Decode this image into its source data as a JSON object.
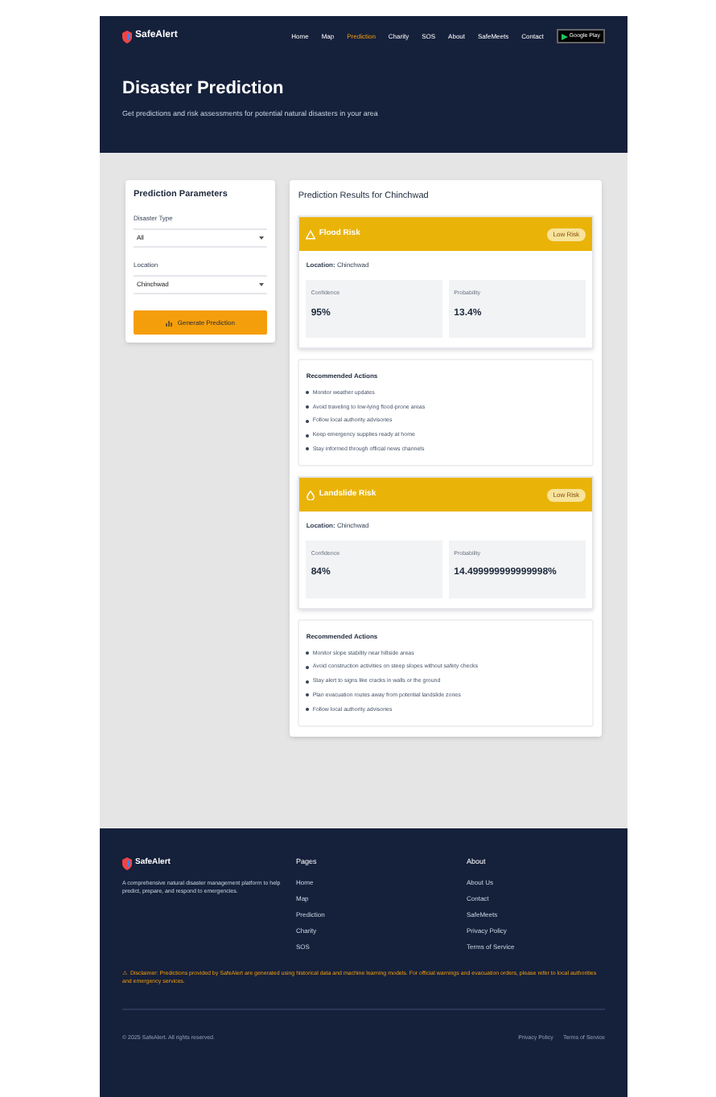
{
  "nav": {
    "brand": "SafeAlert",
    "links": [
      {
        "label": "Home",
        "selected": false
      },
      {
        "label": "Map",
        "selected": false
      },
      {
        "label": "Prediction",
        "selected": true
      },
      {
        "label": "Charity",
        "selected": false
      },
      {
        "label": "SOS",
        "selected": false
      },
      {
        "label": "About",
        "selected": false
      },
      {
        "label": "SafeMeets",
        "selected": false
      },
      {
        "label": "Contact",
        "selected": false
      }
    ],
    "store_badge": "Google Play"
  },
  "hero": {
    "title": "Disaster Prediction",
    "subtitle": "Get predictions and risk assessments for potential natural disasters in your area"
  },
  "parameters": {
    "title": "Prediction Parameters",
    "fields": [
      {
        "label": "Disaster Type",
        "value": "All"
      },
      {
        "label": "Location",
        "value": "Chinchwad"
      }
    ],
    "button": "Generate Prediction"
  },
  "results": {
    "title": "Prediction Results for Chinchwad",
    "risks": [
      {
        "kind": "flood",
        "title": "Flood Risk",
        "badge": "Low Risk",
        "location_label": "Location:",
        "location": "Chinchwad",
        "stats": [
          {
            "label": "Confidence",
            "value": "95%"
          },
          {
            "label": "Probability",
            "value": "13.4%"
          }
        ],
        "actions_title": "Recommended Actions",
        "actions": [
          "Monitor weather updates",
          "Avoid traveling to low-lying flood-prone areas",
          "Follow local authority advisories",
          "Keep emergency supplies ready at home",
          "Stay informed through official news channels"
        ]
      },
      {
        "kind": "landslide",
        "title": "Landslide Risk",
        "badge": "Low Risk",
        "location_label": "Location:",
        "location": "Chinchwad",
        "stats": [
          {
            "label": "Confidence",
            "value": "84%"
          },
          {
            "label": "Probability",
            "value": "14.499999999999998%"
          }
        ],
        "actions_title": "Recommended Actions",
        "actions": [
          "Monitor slope stability near hillside areas",
          "Avoid construction activities on steep slopes without safety checks",
          "Stay alert to signs like cracks in walls or the ground",
          "Plan evacuation routes away from potential landslide zones",
          "Follow local authority advisories"
        ]
      }
    ]
  },
  "footer": {
    "brand": "SafeAlert",
    "description": "A comprehensive natural disaster management platform to help predict, prepare, and respond to emergencies.",
    "columns": [
      {
        "title": "Pages",
        "links": [
          "Home",
          "Map",
          "Prediction",
          "Charity",
          "SOS"
        ]
      },
      {
        "title": "About",
        "links": [
          "About Us",
          "Contact",
          "SafeMeets",
          "Privacy Policy",
          "Terms of Service"
        ]
      }
    ],
    "disclaimer": "⚠ Disclaimer: Predictions provided by SafeAlert are generated using historical data and machine learning models. For official warnings and evacuation orders, please refer to local authorities and emergency services.",
    "copyright": "© 2025 SafeAlert. All rights reserved.",
    "bottom_links": [
      "Privacy Policy",
      "Terms of Service"
    ]
  }
}
